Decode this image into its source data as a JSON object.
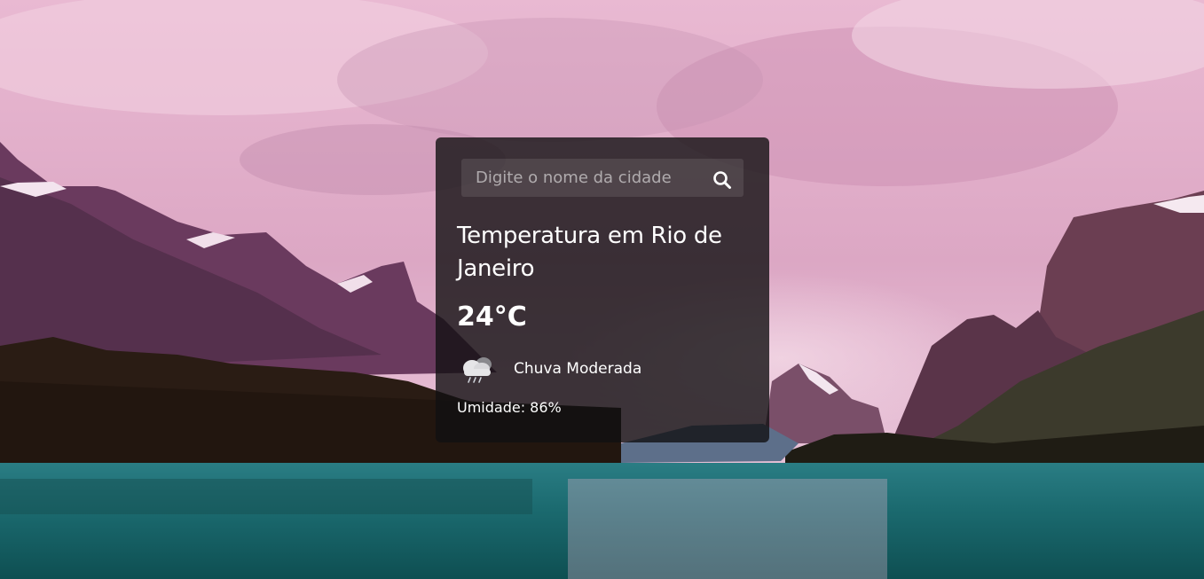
{
  "search": {
    "placeholder": "Digite o nome da cidade",
    "value": "",
    "icon": "search-icon"
  },
  "weather": {
    "title": "Temperatura em Rio de Janeiro",
    "temperature": "24°C",
    "condition": "Chuva Moderada",
    "condition_icon": "rain-cloud-icon",
    "humidity": "Umidade: 86%"
  },
  "colors": {
    "card_bg": "#121012",
    "text": "#ffffff",
    "sky": "#e6b6d0",
    "water": "#1f7f80"
  }
}
